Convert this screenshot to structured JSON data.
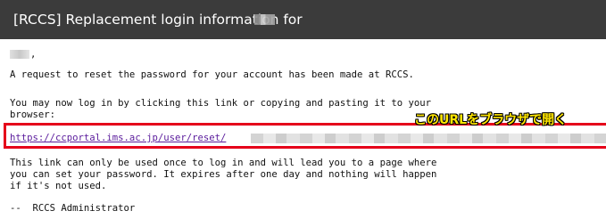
{
  "window": {
    "title": "[RCCS] Replacement login information for"
  },
  "email": {
    "greeting_suffix": ",",
    "request_text": "A request to reset the password for your account has been made at RCCS.",
    "login_text": "You may now log in by clicking this link or copying and pasting it to your\nbrowser:",
    "reset_link": "https://ccportal.ims.ac.jp/user/reset/",
    "callout": "このURLをブラウザで開く",
    "expiry_text": "This link can only be used once to log in and will lead you to a page where\nyou can set your password. It expires after one day and nothing will happen\nif it's not used.",
    "signature": "--  RCCS Administrator"
  },
  "colors": {
    "titlebar_bg": "#3b3b3b",
    "highlight_border": "#e5001a",
    "callout_text": "#ffe600",
    "link": "#5a1b9c"
  }
}
